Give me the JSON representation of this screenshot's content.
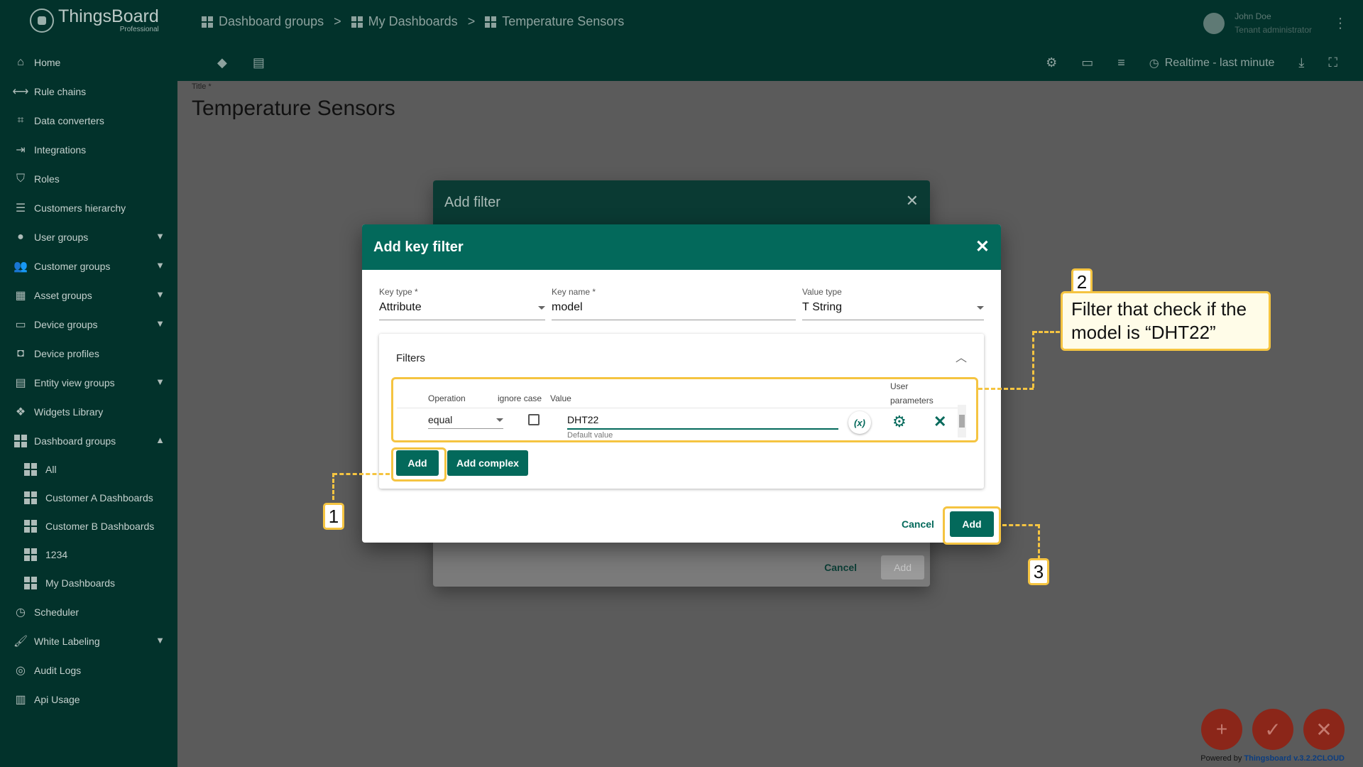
{
  "logo": {
    "title": "ThingsBoard",
    "subtitle": "Professional"
  },
  "sidebar": {
    "items": [
      {
        "label": "Home",
        "icon": "home-icon"
      },
      {
        "label": "Rule chains",
        "icon": "rule-chains-icon"
      },
      {
        "label": "Data converters",
        "icon": "converter-icon"
      },
      {
        "label": "Integrations",
        "icon": "integration-icon"
      },
      {
        "label": "Roles",
        "icon": "shield-icon"
      },
      {
        "label": "Customers hierarchy",
        "icon": "hierarchy-icon"
      },
      {
        "label": "User groups",
        "icon": "account-circle-icon"
      },
      {
        "label": "Customer groups",
        "icon": "people-icon"
      },
      {
        "label": "Asset groups",
        "icon": "domain-icon"
      },
      {
        "label": "Device groups",
        "icon": "devices-icon"
      },
      {
        "label": "Device profiles",
        "icon": "device-profile-icon"
      },
      {
        "label": "Entity view groups",
        "icon": "view-quilt-icon"
      },
      {
        "label": "Widgets Library",
        "icon": "widgets-icon"
      },
      {
        "label": "Dashboard groups",
        "icon": "dashboard-icon"
      }
    ],
    "dashboard_subitems": [
      "All",
      "Customer A Dashboards",
      "Customer B Dashboards",
      "1234",
      "My Dashboards"
    ],
    "bottom_items": [
      {
        "label": "Scheduler",
        "icon": "schedule-icon"
      },
      {
        "label": "White Labeling",
        "icon": "format-paint-icon"
      },
      {
        "label": "Audit Logs",
        "icon": "track-changes-icon"
      },
      {
        "label": "Api Usage",
        "icon": "insert-chart-icon"
      }
    ]
  },
  "breadcrumbs": [
    "Dashboard groups",
    "My Dashboards",
    "Temperature Sensors"
  ],
  "breadcrumb_separator": ">",
  "user": {
    "name": "John Doe",
    "role": "Tenant administrator"
  },
  "toolbar": {
    "realtime_label": "Realtime - last minute"
  },
  "page": {
    "title_label": "Title *",
    "title": "Temperature Sensors"
  },
  "back_dialog": {
    "title": "Add filter",
    "cancel_label": "Cancel",
    "add_label": "Add"
  },
  "key_filter_dialog": {
    "title": "Add key filter",
    "key_type_label": "Key type *",
    "key_type_value": "Attribute",
    "key_name_label": "Key name *",
    "key_name_value": "model",
    "value_type_label": "Value type",
    "value_type_icon": "T",
    "value_type_value": "String",
    "filters_title": "Filters",
    "columns": {
      "operation": "Operation",
      "ignore_case": "ignore case",
      "value": "Value",
      "user_params": "User parameters"
    },
    "row": {
      "operation": "equal",
      "value": "DHT22",
      "value_hint": "Default value",
      "var_label": "(x)"
    },
    "add_label": "Add",
    "add_complex_label": "Add complex",
    "cancel_label": "Cancel",
    "submit_label": "Add"
  },
  "annotations": {
    "num1": "1",
    "num2": "2",
    "num3": "3",
    "note": "Filter that check if the model is “DHT22”"
  },
  "footer": {
    "powered_prefix": "Powered by",
    "powered_brand": "Thingsboard v.3.2.2CLOUD"
  },
  "colors": {
    "accent": "#03695b",
    "sidebar_bg": "#02322b",
    "highlight": "#f5c441",
    "fab": "#8b2619"
  }
}
